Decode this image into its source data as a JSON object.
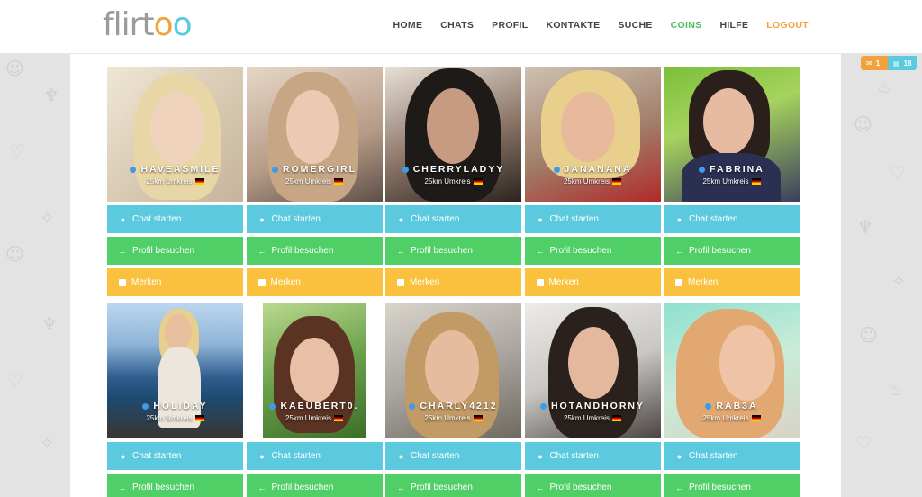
{
  "header": {
    "logo": {
      "part1": "flirt",
      "part2": "o",
      "part3": "o"
    },
    "nav": [
      {
        "id": "home",
        "label": "HOME"
      },
      {
        "id": "chats",
        "label": "CHATS"
      },
      {
        "id": "profil",
        "label": "PROFIL"
      },
      {
        "id": "kontakte",
        "label": "KONTAKTE"
      },
      {
        "id": "suche",
        "label": "SUCHE"
      },
      {
        "id": "coins",
        "label": "COINS"
      },
      {
        "id": "hilfe",
        "label": "HILFE"
      },
      {
        "id": "logout",
        "label": "LOGOUT"
      }
    ]
  },
  "badges": {
    "mail_count": "1",
    "list_count": "18"
  },
  "buttons": {
    "chat": "Chat starten",
    "profil": "Profil besuchen",
    "merken": "Merken"
  },
  "profiles": [
    {
      "name": "HAVEASMILE",
      "distance": "25km Umkreis"
    },
    {
      "name": "ROMERGIRL",
      "distance": "25km Umkreis"
    },
    {
      "name": "CHERRYLADYY",
      "distance": "25km Umkreis"
    },
    {
      "name": "JANANANA",
      "distance": "25km Umkreis"
    },
    {
      "name": "FABRINA",
      "distance": "25km Umkreis"
    },
    {
      "name": "HOLIDAY",
      "distance": "25km Umkreis"
    },
    {
      "name": "KAEUBERT0.",
      "distance": "25km Umkreis"
    },
    {
      "name": "CHARLY4212",
      "distance": "25km Umkreis"
    },
    {
      "name": "HOTANDHORNY",
      "distance": "25km Umkreis"
    },
    {
      "name": "RAB3A",
      "distance": "25km Umkreis"
    }
  ],
  "colors": {
    "chat": "#5bc9de",
    "profil": "#4fcf66",
    "merken": "#f9c13e",
    "coins": "#45c15c",
    "logout": "#f2a23c",
    "online": "#3d9be9"
  }
}
